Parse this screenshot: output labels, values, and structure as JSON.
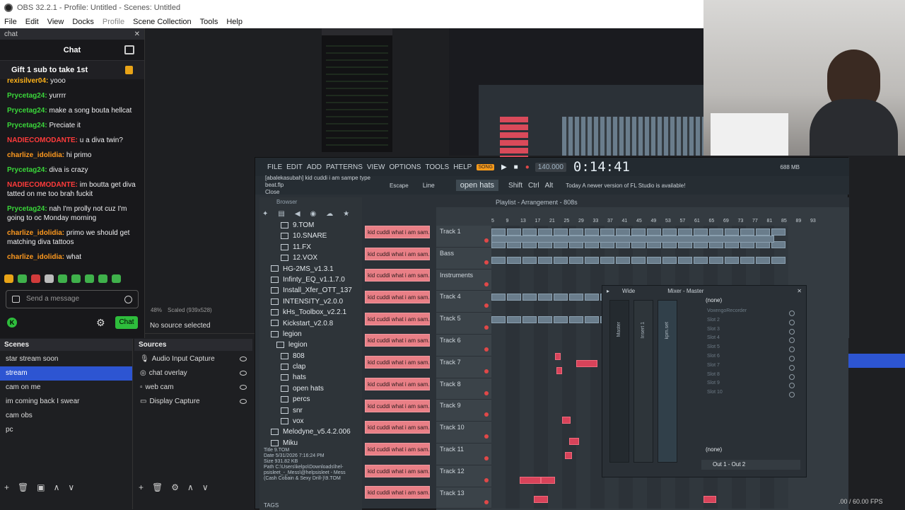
{
  "obs": {
    "title": "OBS 32.2.1 - Profile: Untitled - Scenes: Untitled",
    "menu": [
      "File",
      "Edit",
      "View",
      "Docks",
      "Profile",
      "Scene Collection",
      "Tools",
      "Help"
    ],
    "fps": ".00 / 60.00 FPS",
    "no_source": "No source selected",
    "preview_zoom": "48%",
    "preview_scaled": "Scaled (939x528)"
  },
  "chat": {
    "dock_title": "chat",
    "header": "Chat",
    "pinned": "Gift 1 sub to take 1st",
    "messages": [
      {
        "user": "rexisilver04",
        "text": "yooo",
        "color": "#ffb31a"
      },
      {
        "user": "Prycetag24",
        "text": "yurrrr",
        "color": "#3ad63a"
      },
      {
        "user": "Prycetag24",
        "text": "make a song bouta hellcat",
        "color": "#3ad63a"
      },
      {
        "user": "Prycetag24",
        "text": "Preciate it",
        "color": "#3ad63a"
      },
      {
        "user": "NADIECOMODANTE",
        "text": "u a diva twin?",
        "color": "#ff3b3b"
      },
      {
        "user": "charlize_idolidia",
        "text": "hi primo",
        "color": "#ff9a1f"
      },
      {
        "user": "Prycetag24",
        "text": "diva is crazy",
        "color": "#3ad63a"
      },
      {
        "user": "NADIECOMODANTE",
        "text": "im boutta get diva tatted on me too brah fuckit",
        "color": "#ff3b3b"
      },
      {
        "user": "Prycetag24",
        "text": "nah I'm prolly not cuz I'm going to oc Monday morning",
        "color": "#3ad63a"
      },
      {
        "user": "charlize_idolidia",
        "text": "primo we should get matching diva tattoos",
        "color": "#ff9a1f"
      },
      {
        "user": "charlize_idolidia",
        "text": "what",
        "color": "#ff9a1f"
      }
    ],
    "input_placeholder": "Send a message",
    "send_label": "Chat"
  },
  "scenes": {
    "title": "Scenes",
    "items": [
      "star stream soon",
      "stream",
      "cam on me",
      "im coming back I swear",
      "cam obs",
      "pc"
    ],
    "selected": "stream"
  },
  "sources": {
    "title": "Sources",
    "items": [
      "Audio Input Capture",
      "chat overlay",
      "web cam",
      "Display Capture"
    ]
  },
  "fl": {
    "menu": [
      "FILE",
      "EDIT",
      "ADD",
      "PATTERNS",
      "VIEW",
      "OPTIONS",
      "TOOLS",
      "HELP"
    ],
    "song_label": "SONG",
    "bpm": "140.000",
    "time": "0:14:41",
    "memory": "688 MB",
    "project_hint": "[abalekasubah] kid cuddi i am sampe type beat.flp",
    "close": "Close",
    "escape": "Escape",
    "line_mode": "Line",
    "pattern": "open hats",
    "modifiers": [
      "Shift",
      "Ctrl",
      "Alt"
    ],
    "news": "Today  A newer version of FL Studio is available!",
    "browser": {
      "title": "Browser",
      "items": [
        "9.TOM",
        "10.SNARE",
        "11.FX",
        "12.VOX",
        "HG-2MS_v1.3.1",
        "Infinty_EQ_v1.1.7.0",
        "Install_Xfer_OTT_137",
        "INTENSITY_v2.0.0",
        "kHs_Toolbox_v2.2.1",
        "Kickstart_v2.0.8",
        "legion",
        "legion",
        "808",
        "clap",
        "hats",
        "open hats",
        "percs",
        "snr",
        "vox",
        "Melodyne_v5.4.2.006",
        "Miku"
      ],
      "info_title": "Title  9.TOM",
      "info_date": "Date  5/31/2026 7:16:24 PM",
      "info_size": "Size  931.82 KB",
      "info_path": "Path  C:\\Users\\kelpo\\Downloads\\hel-psisleet_-_Mess\\@helpsisleet - Mess (Cash Cobain & Sexy Drill-)\\9.TOM",
      "tags": "TAGS"
    },
    "rack_label": "kid cuddi what i am sam...",
    "playlist_title": "Playlist - Arrangement",
    "playlist_pattern": "808s",
    "ruler": [
      "5",
      "9",
      "13",
      "17",
      "21",
      "25",
      "29",
      "33",
      "37",
      "41",
      "45",
      "49",
      "53",
      "57",
      "61",
      "65",
      "69",
      "73",
      "77",
      "81",
      "85",
      "89",
      "93"
    ],
    "tracks": [
      "Track 1",
      "Bass",
      "Instruments",
      "Track 4",
      "Track 5",
      "Track 6",
      "Track 7",
      "Track 8",
      "Track 9",
      "Track 10",
      "Track 11",
      "Track 12",
      "Track 13"
    ],
    "mixer": {
      "title": "Mixer - Master",
      "mode": "Wide",
      "strips": [
        "Master",
        "Insert 1",
        "kpm.set"
      ],
      "slot_top": "(none)",
      "slots": [
        "VoxengoRecorder",
        "Slot 2",
        "Slot 3",
        "Slot 4",
        "Slot 5",
        "Slot 6",
        "Slot 7",
        "Slot 8",
        "Slot 9",
        "Slot 10"
      ],
      "slot_bottom": "(none)",
      "output": "Out 1 - Out 2"
    }
  }
}
